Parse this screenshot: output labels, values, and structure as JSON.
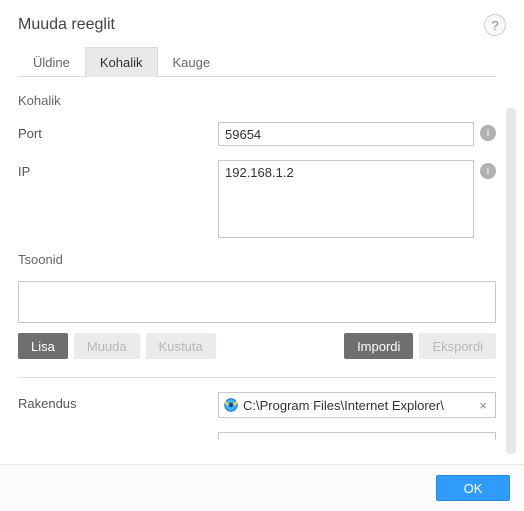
{
  "title": "Muuda reeglit",
  "helpGlyph": "?",
  "tabs": [
    {
      "label": "Üldine",
      "active": false
    },
    {
      "label": "Kohalik",
      "active": true
    },
    {
      "label": "Kauge",
      "active": false
    }
  ],
  "section": {
    "heading": "Kohalik",
    "port": {
      "label": "Port",
      "value": "59654"
    },
    "ip": {
      "label": "IP",
      "value": "192.168.1.2"
    },
    "zones": {
      "label": "Tsoonid"
    },
    "application": {
      "label": "Rakendus",
      "value": "C:\\Program Files\\Internet Explorer\\"
    }
  },
  "buttons": {
    "add": "Lisa",
    "edit": "Muuda",
    "delete": "Kustuta",
    "import": "Impordi",
    "export": "Ekspordi",
    "ok": "OK"
  },
  "infoGlyph": "i",
  "clearGlyph": "×"
}
